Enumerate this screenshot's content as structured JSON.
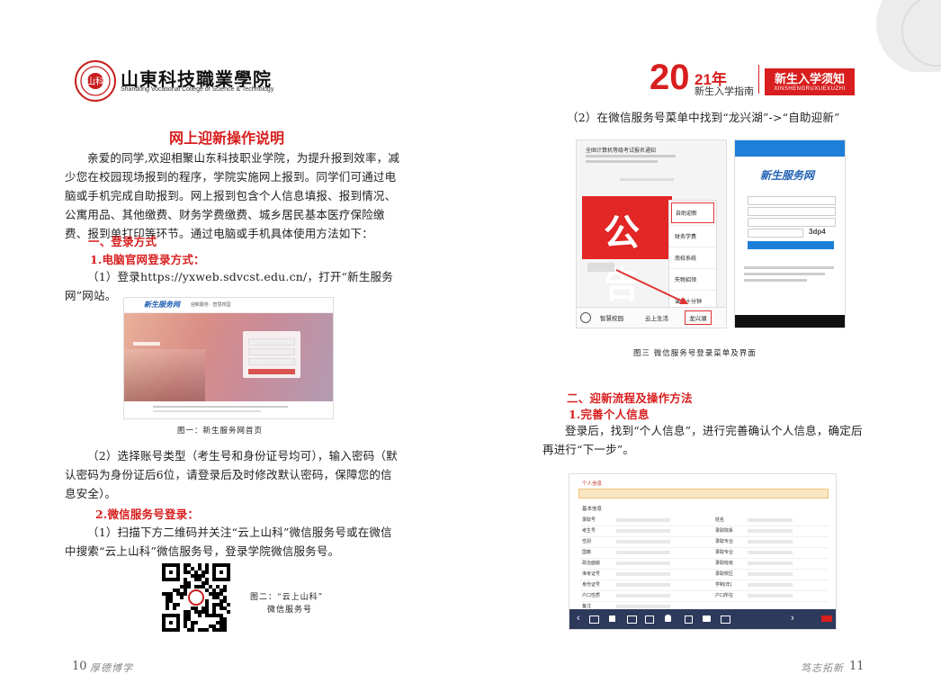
{
  "header_left": {
    "school_name_cn": "山東科技職業學院",
    "school_name_en": "Shandong Vocational College of Science & Technology"
  },
  "header_right": {
    "year_big": "20",
    "year_small": "21年",
    "guide": "新生入学指南",
    "badge_title": "新生入学须知",
    "badge_pinyin": "XINSHENGRUXUEXUZHI"
  },
  "left": {
    "title": "网上迎新操作说明",
    "intro": "亲爱的同学,欢迎相聚山东科技职业学院，为提升报到效率，减少您在校园现场报到的程序，学院实施网上报到。同学们可通过电脑或手机完成自助报到。网上报到包含个人信息填报、报到情况、公寓用品、其他缴费、财务学费缴费、城乡居民基本医疗保险缴费、报到单打印等环节。通过电脑或手机具体使用方法如下：",
    "section1": "一、登录方式",
    "sub1": "1.电脑官网登录方式：",
    "step1": "（1）登录https://yxweb.sdvcst.edu.cn/，打开“新生服务网”网站。",
    "fig1_site_logo": "新生服务网",
    "fig1_site_sub": "迎新服务 · 智慧校园",
    "fig1_caption": "图一：新生服务网首页",
    "step2": "（2）选择账号类型（考生号和身份证号均可），输入密码（默认密码为身份证后6位，请登录后及时修改默认密码，保障您的信息安全）。",
    "sub2": "2.微信服务号登录：",
    "step3": "（1）扫描下方二维码并关注“云上山科”微信服务号或在微信中搜索“云上山科”微信服务号，登录学院微信服务号。",
    "fig2_caption_line1": "图二：“云上山科”",
    "fig2_caption_line2": "微信服务号"
  },
  "right": {
    "step_wechat": "（2）在微信服务号菜单中找到“龙兴湖”->“自助迎新”",
    "fig3": {
      "notice_title": "全国计算机等级考试报名通知",
      "big_text": "公告",
      "menu": [
        "自助迎新",
        "财务学费",
        "南校系统",
        "失物招领",
        "课间十分钟"
      ],
      "bottom_tabs": [
        "智慧校园",
        "云上生活",
        "龙兴湖"
      ],
      "phone_logo": "新生服务网",
      "phone_captcha": "3dp4"
    },
    "fig3_caption": "图三 微信服务号登录菜单及界面",
    "section2": "二、迎新流程及操作方法",
    "sub1": "1.完善个人信息",
    "step1": "登录后，找到“个人信息”，进行完善确认个人信息，确定后再进行“下一步”。",
    "fig4_tab": "个人信息",
    "fig4_section": "基本信息",
    "fig4_rows": [
      "录取号",
      "考生号",
      "性别",
      "国籍",
      "政治面貌",
      "准考证号",
      "身份证号",
      "户口性质",
      "备注"
    ],
    "fig4_rows_right": [
      "姓名",
      "录取院系",
      "录取专业",
      "录取专业",
      "录取班级",
      "录取校区",
      "学制(年)",
      "户口所在"
    ]
  },
  "footer": {
    "left_page": "10",
    "left_motto": "厚德博学",
    "right_motto": "笃志拓新",
    "right_page": "11"
  },
  "colors": {
    "accent_red": "#d81e1e",
    "navy": "#2e3a5c"
  }
}
